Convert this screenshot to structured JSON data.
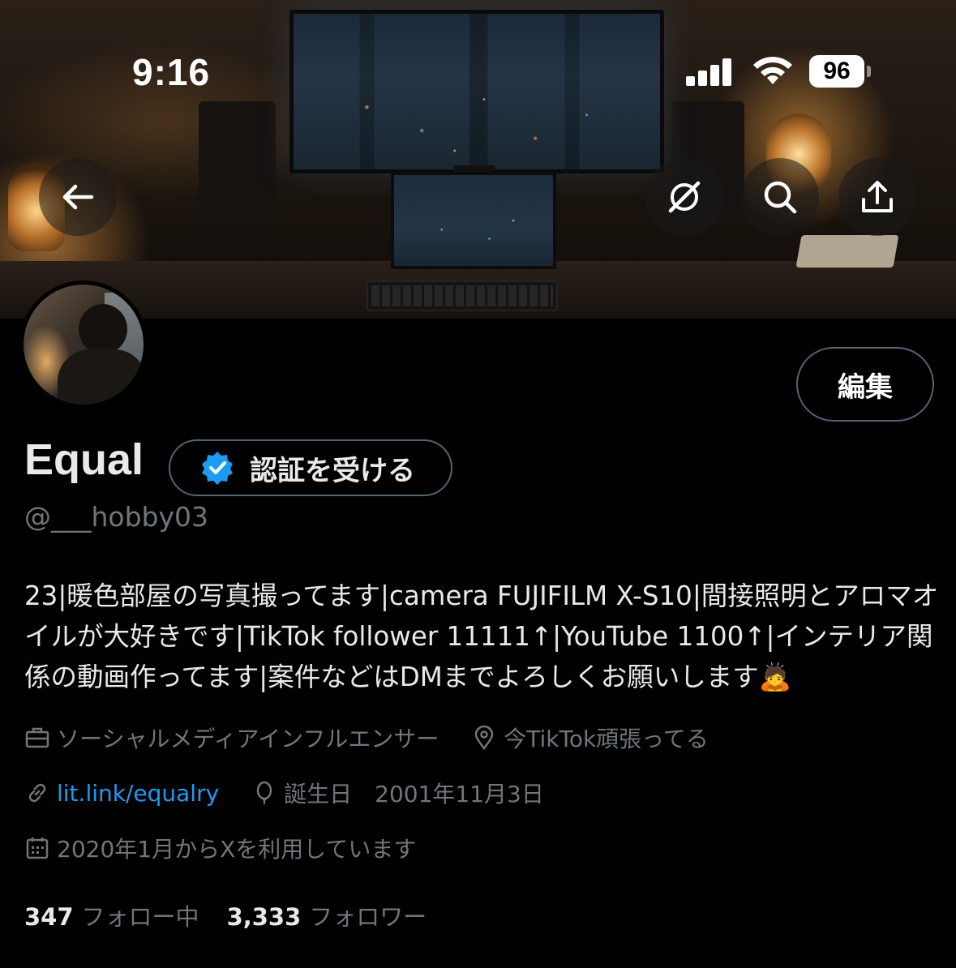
{
  "status_bar": {
    "time": "9:16",
    "battery_level": "96"
  },
  "nav": {
    "back_icon": "arrow-left-icon",
    "grok_icon": "grok-icon",
    "search_icon": "search-icon",
    "share_icon": "share-icon"
  },
  "profile": {
    "edit_label": "編集",
    "display_name": "Equal",
    "verify_label": "認証を受ける",
    "handle": "@___hobby03",
    "bio": "23|暖色部屋の写真撮ってます|camera FUJIFILM X-S10|間接照明とアロマオイルが大好きです|TikTok follower 11111↑|YouTube 1100↑|インテリア関係の動画作ってます|案件などはDMまでよろしくお願いします🙇",
    "category": "ソーシャルメディアインフルエンサー",
    "location": "今TikTok頑張ってる",
    "website": "lit.link/equalry",
    "birthday": "誕生日　2001年11月3日",
    "joined": "2020年1月からXを利用しています",
    "following_count": "347",
    "following_label": "フォロー中",
    "followers_count": "3,333",
    "followers_label": "フォロワー"
  },
  "colors": {
    "background": "#000000",
    "text_primary": "#e7e9ea",
    "text_secondary": "#71767b",
    "link": "#1d9bf0",
    "border": "#536471",
    "verified_badge": "#1d9bf0"
  }
}
